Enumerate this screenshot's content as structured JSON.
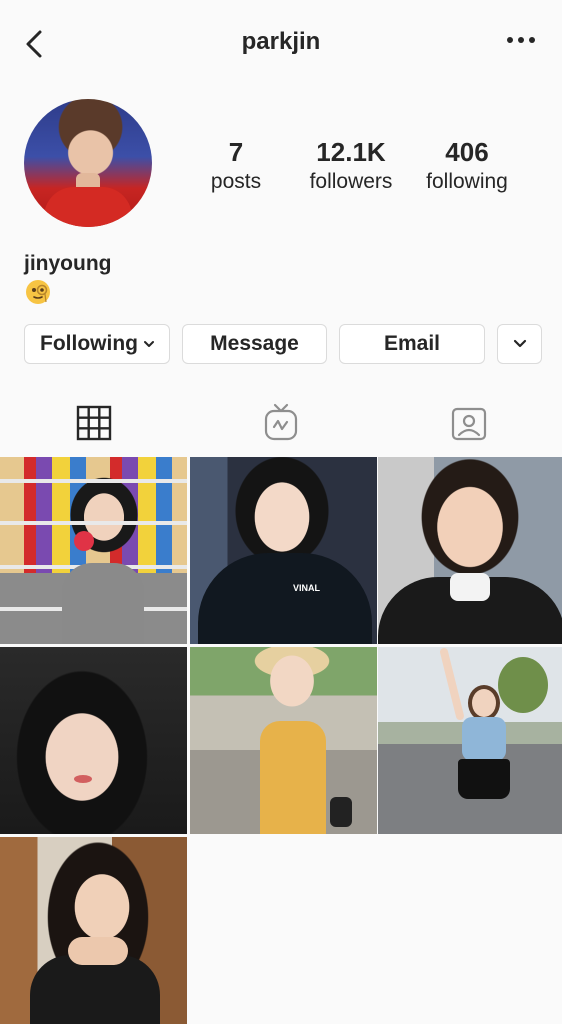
{
  "header": {
    "back_icon": "chevron-left-icon",
    "title": "parkjin",
    "more_icon": "more-horizontal-icon"
  },
  "profile": {
    "stats": [
      {
        "value": "7",
        "label": "posts"
      },
      {
        "value": "12.1K",
        "label": "followers"
      },
      {
        "value": "406",
        "label": "following"
      }
    ],
    "name": "jinyoung",
    "bio_emoji": "face-with-monocle-emoji"
  },
  "actions": {
    "following_label": "Following",
    "message_label": "Message",
    "email_label": "Email",
    "more_icon": "chevron-down-icon"
  },
  "tabs": [
    {
      "icon": "grid-icon",
      "active": true
    },
    {
      "icon": "igtv-icon",
      "active": false
    },
    {
      "icon": "tagged-icon",
      "active": false
    }
  ],
  "posts": [
    {
      "id": "post-1",
      "text": ""
    },
    {
      "id": "post-2",
      "text": "VINAL"
    },
    {
      "id": "post-3",
      "text": ""
    },
    {
      "id": "post-4",
      "text": ""
    },
    {
      "id": "post-5",
      "text": ""
    },
    {
      "id": "post-6",
      "text": ""
    },
    {
      "id": "post-7",
      "text": ""
    }
  ]
}
